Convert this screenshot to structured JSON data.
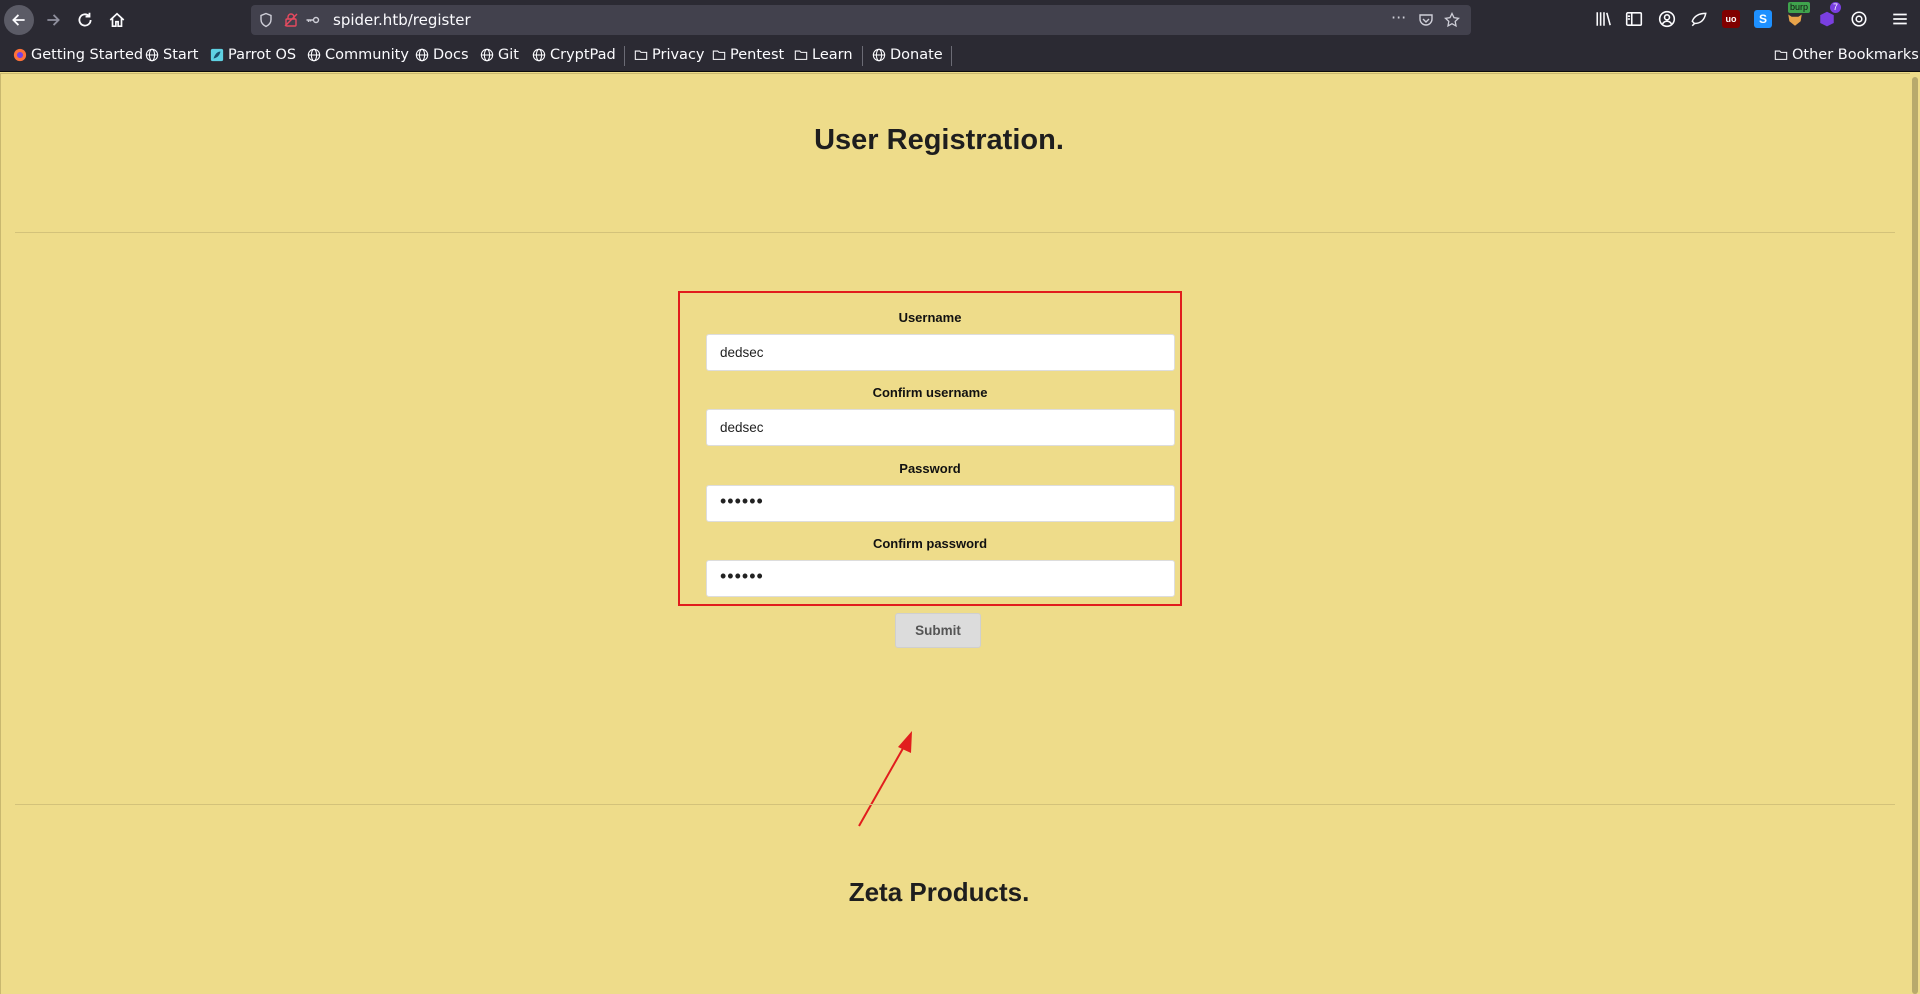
{
  "browser": {
    "url": "spider.htb/register",
    "burp_badge": "burp",
    "ext_count": "7",
    "bookmarks": [
      {
        "label": "Getting Started",
        "icon": "firefox-icon"
      },
      {
        "label": "Start",
        "icon": "globe-icon"
      },
      {
        "label": "Parrot OS",
        "icon": "parrot-icon"
      },
      {
        "label": "Community",
        "icon": "globe-icon"
      },
      {
        "label": "Docs",
        "icon": "globe-icon"
      },
      {
        "label": "Git",
        "icon": "globe-icon"
      },
      {
        "label": "CryptPad",
        "icon": "globe-icon"
      },
      {
        "label": "Privacy",
        "icon": "folder-icon"
      },
      {
        "label": "Pentest",
        "icon": "folder-icon"
      },
      {
        "label": "Learn",
        "icon": "folder-icon"
      },
      {
        "label": "Donate",
        "icon": "globe-icon"
      }
    ],
    "other_bookmarks": "Other Bookmarks"
  },
  "page": {
    "title": "User Registration.",
    "form": {
      "username_label": "Username",
      "username_value": "dedsec",
      "confirm_username_label": "Confirm username",
      "confirm_username_value": "dedsec",
      "password_label": "Password",
      "password_value": "••••••",
      "confirm_password_label": "Confirm password",
      "confirm_password_value": "••••••",
      "submit_label": "Submit"
    },
    "section_title": "Zeta Products."
  },
  "colors": {
    "page_bg": "#eedc8a",
    "highlight": "#e11d1d",
    "chrome_bg": "#2b2a33"
  }
}
